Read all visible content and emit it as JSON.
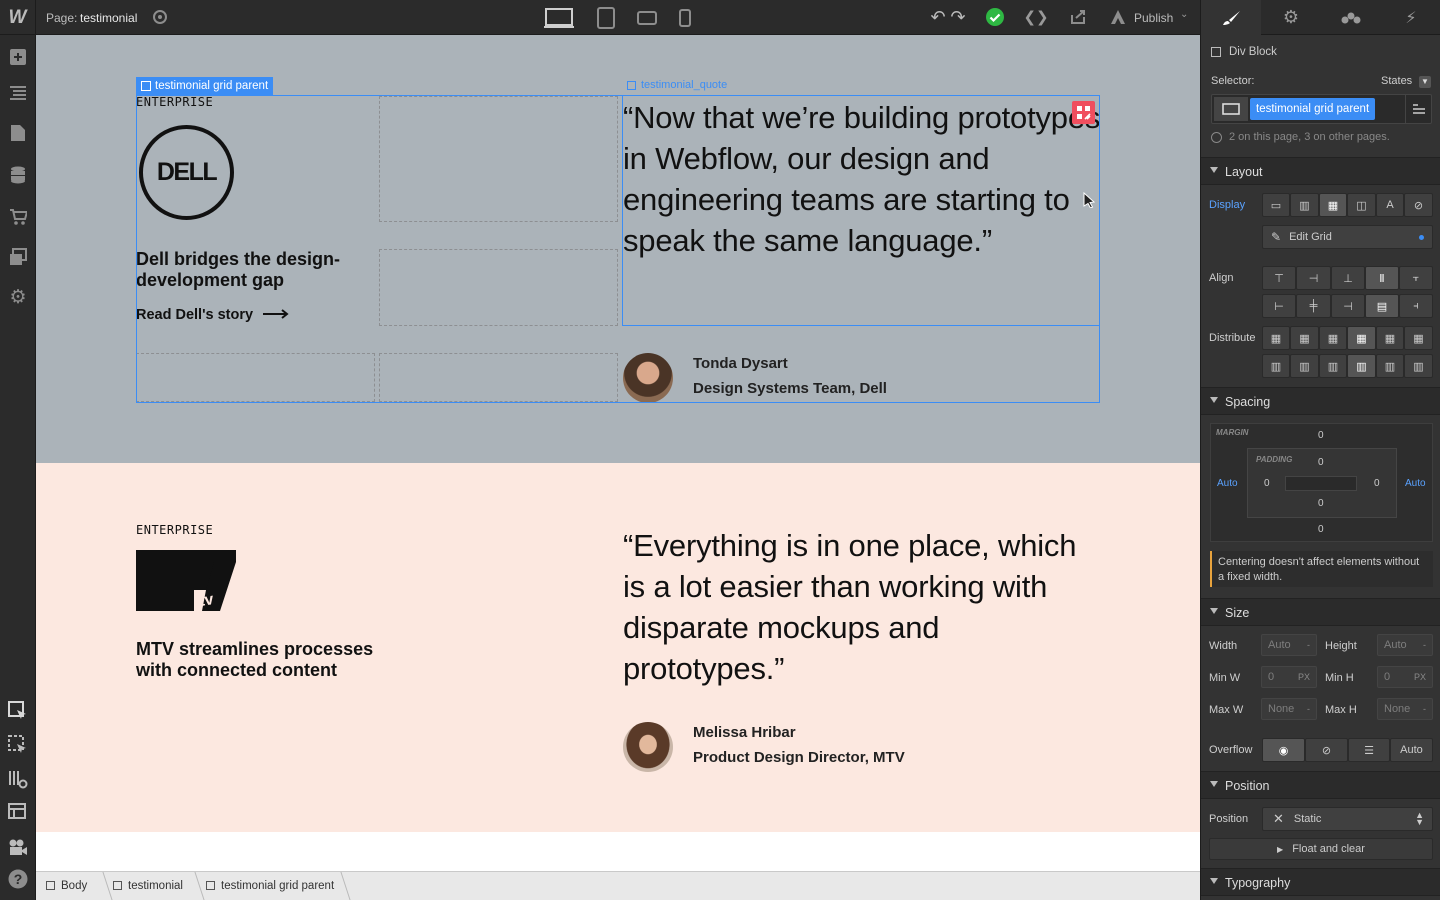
{
  "topbar": {
    "page_label": "Page:",
    "page_name": "testimonial",
    "publish_label": "Publish",
    "logo": "W"
  },
  "canvas": {
    "section1": {
      "eyebrow": "ENTERPRISE",
      "logo_text": "DELL",
      "title": "Dell bridges the design-development gap",
      "link": "Read Dell's story",
      "quote": "“Now that we’re building prototypes in Webflow, our design and engineering teams are starting to speak the same language.”",
      "person_name": "Tonda Dysart",
      "person_role": "Design Systems Team, Dell"
    },
    "section2": {
      "eyebrow": "ENTERPRISE",
      "title": "MTV streamlines processes with connected content",
      "quote": "“Everything is in one place, which is a lot easier than working with disparate mockups and prototypes.”",
      "person_name": "Melissa Hribar",
      "person_role": "Product Design Director, MTV"
    },
    "selection_label": "testimonial grid parent",
    "hover_label": "testimonial_quote"
  },
  "breadcrumb": [
    "Body",
    "testimonial",
    "testimonial grid parent"
  ],
  "panel": {
    "element_type": "Div Block",
    "selector_label": "Selector:",
    "states_label": "States",
    "selector_chip": "testimonial grid parent",
    "usage_note": "2 on this page, 3 on other pages.",
    "layout": {
      "title": "Layout",
      "display_label": "Display",
      "edit_grid_label": "Edit Grid",
      "align_label": "Align",
      "distribute_label": "Distribute"
    },
    "spacing": {
      "title": "Spacing",
      "margin_label": "MARGIN",
      "padding_label": "PADDING",
      "margin_top": "0",
      "margin_bottom": "0",
      "margin_left": "Auto",
      "margin_right": "Auto",
      "padding_top": "0",
      "padding_bottom": "0",
      "padding_left": "0",
      "padding_right": "0",
      "note": "Centering doesn't affect elements without a fixed width."
    },
    "size": {
      "title": "Size",
      "width_label": "Width",
      "width_value": "Auto",
      "height_label": "Height",
      "height_value": "Auto",
      "minw_label": "Min W",
      "minw_value": "0",
      "minh_label": "Min H",
      "minh_value": "0",
      "maxw_label": "Max W",
      "maxw_value": "None",
      "maxh_label": "Max H",
      "maxh_value": "None",
      "unit_dash": "-",
      "unit_px": "PX",
      "overflow_label": "Overflow",
      "overflow_auto": "Auto"
    },
    "position": {
      "title": "Position",
      "position_label": "Position",
      "position_value": "Static",
      "float_label": "Float and clear"
    },
    "typography": {
      "title": "Typography"
    }
  },
  "colors": {
    "selection_blue": "#3b8df5",
    "section1_bg": "#abb3b9",
    "section2_bg": "#fce8e0",
    "panel_bg": "#333333",
    "publish_check": "#2eb843"
  }
}
